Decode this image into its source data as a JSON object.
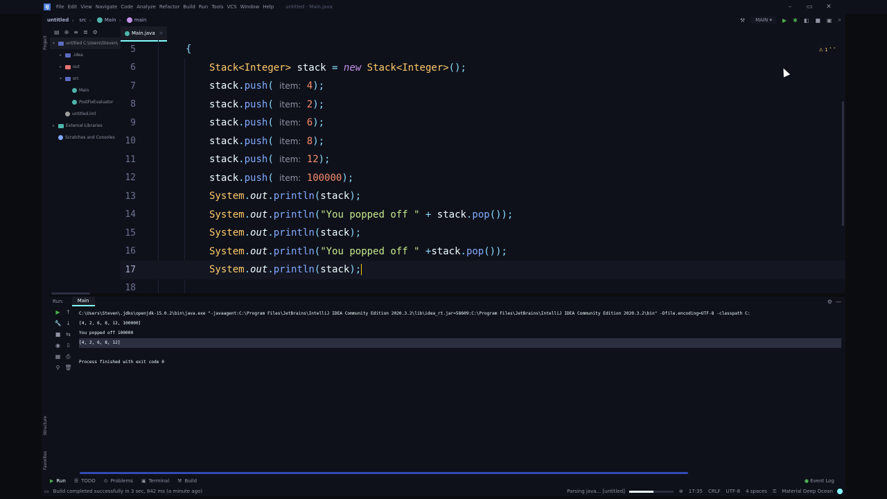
{
  "app": {
    "icon_letter": "IJ",
    "window_title": "untitled - Main.java"
  },
  "menu": [
    "File",
    "Edit",
    "View",
    "Navigate",
    "Code",
    "Analyze",
    "Refactor",
    "Build",
    "Run",
    "Tools",
    "VCS",
    "Window",
    "Help"
  ],
  "window_controls": {
    "minimize": "–",
    "restore": "▭",
    "close": "✕"
  },
  "breadcrumb": [
    "untitled",
    "src",
    "Main",
    "main"
  ],
  "run_config": "MAIN",
  "left_strip_labels": {
    "project": "Project",
    "structure": "Structure",
    "favorites": "Favorites"
  },
  "project_tree": [
    {
      "label": "untitled  C:\\Users\\Steven\\",
      "depth": 0,
      "arrow": "▾",
      "kind": "folder",
      "color": "#5c6bc0"
    },
    {
      "label": ".idea",
      "depth": 1,
      "arrow": "▸",
      "kind": "folder",
      "color": "#5c6bc0"
    },
    {
      "label": "out",
      "depth": 1,
      "arrow": "▸",
      "kind": "folder",
      "color": "#e57373"
    },
    {
      "label": "src",
      "depth": 1,
      "arrow": "▾",
      "kind": "folder",
      "color": "#5c6bc0"
    },
    {
      "label": "Main",
      "depth": 2,
      "arrow": "",
      "kind": "file",
      "color": "#4db6ac"
    },
    {
      "label": "PostFixEvaluator",
      "depth": 2,
      "arrow": "",
      "kind": "file",
      "color": "#4db6ac"
    },
    {
      "label": "untitled.iml",
      "depth": 1,
      "arrow": "",
      "kind": "file",
      "color": "#9e9e9e"
    },
    {
      "label": "External Libraries",
      "depth": 0,
      "arrow": "▸",
      "kind": "folder",
      "color": "#4db6ac"
    },
    {
      "label": "Scratches and Consoles",
      "depth": 0,
      "arrow": "",
      "kind": "file",
      "color": "#82aaff"
    }
  ],
  "editor": {
    "tab_label": "Main.java",
    "warning_count": "1",
    "line_numbers": [
      "5",
      "6",
      "7",
      "8",
      "9",
      "10",
      "11",
      "12",
      "13",
      "14",
      "15",
      "16",
      "17",
      "18"
    ],
    "open_brace": "{",
    "decl": {
      "type1": "Stack",
      "gen1": "<Integer>",
      "var": "stack",
      "eq": "=",
      "kw_new": "new",
      "type2": "Stack",
      "gen2": "<Integer>",
      "tail": "();"
    },
    "push_hint": "item:",
    "push_values": [
      "4",
      "2",
      "6",
      "8",
      "12",
      "100000"
    ],
    "sys": "System",
    "out": "out",
    "println": "println",
    "pop_string": "\"You popped off \"",
    "stack_ident": "stack",
    "pop_call": "pop"
  },
  "run_panel": {
    "label": "Run:",
    "tab": "Main",
    "console_lines": [
      "C:\\Users\\Steven\\.jdks\\openjdk-15.0.2\\bin\\java.exe \"-javaagent:C:\\Program Files\\JetBrains\\IntelliJ IDEA Community Edition 2020.3.2\\lib\\idea_rt.jar=58609:C:\\Program Files\\JetBrains\\IntelliJ IDEA Community Edition 2020.3.2\\bin\" -Dfile.encoding=UTF-8 -classpath C:",
      "[4, 2, 6, 8, 12, 100000]",
      "You popped off 100000",
      "[4, 2, 6, 8, 12]",
      "",
      "Process finished with exit code 0"
    ]
  },
  "tool_windows": [
    "Run",
    "TODO",
    "Problems",
    "Terminal",
    "Build"
  ],
  "event_log": "Event Log",
  "status": {
    "message": "Build completed successfully in 3 sec, 842 ms (a minute ago)",
    "parsing": "Parsing java... [untitled]",
    "parsing_progress": 0.55,
    "position": "17:35",
    "line_sep": "CRLF",
    "encoding": "UTF-8",
    "indent": "4 spaces",
    "theme": "Material Deep Ocean"
  }
}
